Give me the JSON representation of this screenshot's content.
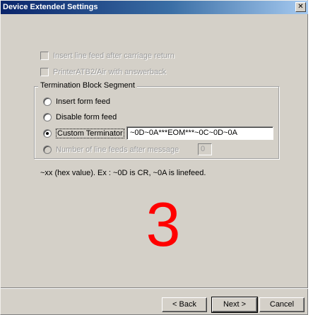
{
  "window": {
    "title": "Device Extended Settings",
    "close_glyph": "✕"
  },
  "options": {
    "insert_line_feed": {
      "label": "Insert line feed after carriage return",
      "checked": false,
      "enabled": false
    },
    "printer_answerback": {
      "label": "PrinterATB2/Air with answerback",
      "checked": false,
      "enabled": false
    }
  },
  "termination_group": {
    "title": "Termination Block Segment",
    "insert_form_feed": {
      "label": "Insert form feed",
      "selected": false
    },
    "disable_form_feed": {
      "label": "Disable form feed",
      "selected": false
    },
    "custom_terminator": {
      "label": "Custom Terminator",
      "selected": true,
      "value": "~0D~0A***EOM***~0C~0D~0A"
    },
    "line_feeds": {
      "label": "Number of line feeds after message",
      "selected": false,
      "enabled": false,
      "value": "0"
    }
  },
  "hint_text": "~xx (hex value). Ex : ~0D is CR, ~0A is linefeed.",
  "overlay_number": "3",
  "buttons": {
    "back_label": "< Back",
    "next_label": "Next >",
    "cancel_label": "Cancel"
  },
  "colors": {
    "title_bar": "#0a246a",
    "overlay_number": "#ff0000",
    "dialog_bg": "#d4d0c8"
  }
}
